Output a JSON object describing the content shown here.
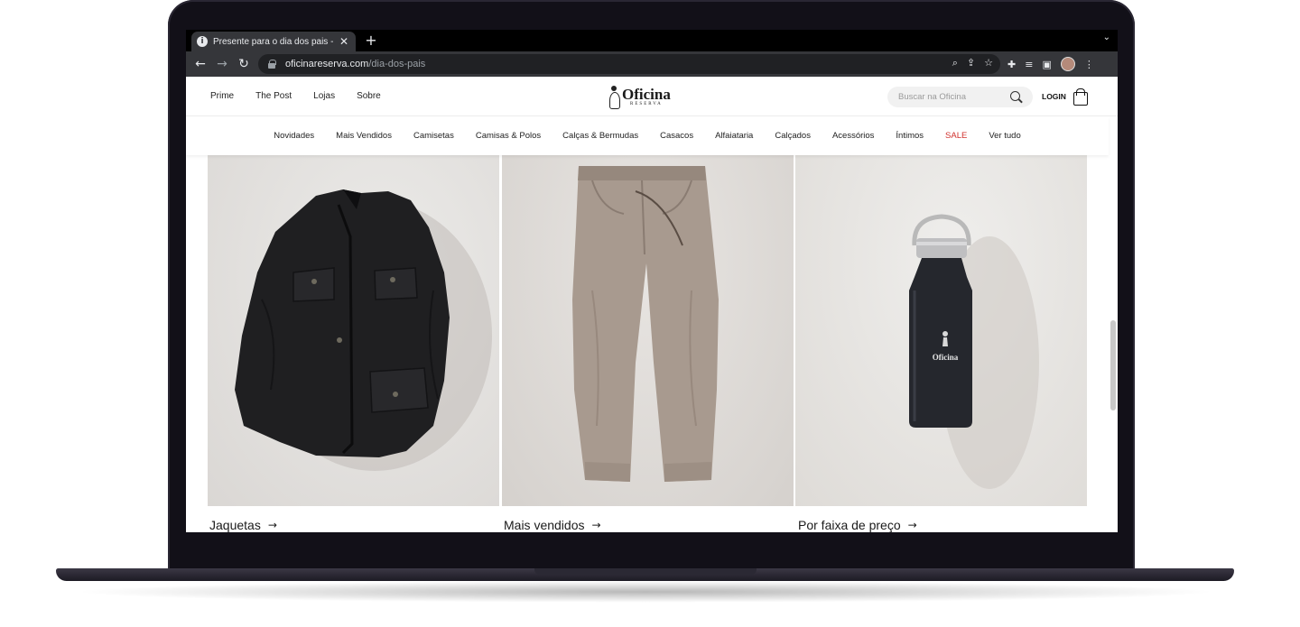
{
  "browser": {
    "tab_title": "Presente para o dia dos pais -",
    "tab_favicon": "i",
    "tab_close": "✕",
    "new_tab": "+",
    "tab_menu": "⌄",
    "url_host": "oficinareserva.com",
    "url_path": "/dia-dos-pais",
    "back": "←",
    "forward": "→",
    "reload": "↻",
    "omni_icons": [
      "⌕",
      "⇪",
      "☆"
    ],
    "ext_icons": [
      "✚",
      "≡",
      "▣",
      "⋮"
    ]
  },
  "header": {
    "top_links": [
      "Prime",
      "The Post",
      "Lojas",
      "Sobre"
    ],
    "logo_word": "Oficina",
    "logo_sub": "RESERVA",
    "search_placeholder": "Buscar na Oficina",
    "login_label": "LOGIN"
  },
  "categories": [
    {
      "label": "Novidades",
      "sale": false
    },
    {
      "label": "Mais Vendidos",
      "sale": false
    },
    {
      "label": "Camisetas",
      "sale": false
    },
    {
      "label": "Camisas & Polos",
      "sale": false
    },
    {
      "label": "Calças & Bermudas",
      "sale": false
    },
    {
      "label": "Casacos",
      "sale": false
    },
    {
      "label": "Alfaiataria",
      "sale": false
    },
    {
      "label": "Calçados",
      "sale": false
    },
    {
      "label": "Acessórios",
      "sale": false
    },
    {
      "label": "Íntimos",
      "sale": false
    },
    {
      "label": "SALE",
      "sale": true
    },
    {
      "label": "Ver tudo",
      "sale": false
    }
  ],
  "products": [
    {
      "caption": "Jaquetas",
      "image": "black-jacket"
    },
    {
      "caption": "Mais vendidos",
      "image": "beige-pants"
    },
    {
      "caption": "Por faixa de preço",
      "image": "black-bottle"
    }
  ],
  "bottle_logo": "Oficina",
  "arrow": "→",
  "colors": {
    "sale": "#d0312d",
    "chrome_dark": "#35363a",
    "laptop": "#121018"
  }
}
